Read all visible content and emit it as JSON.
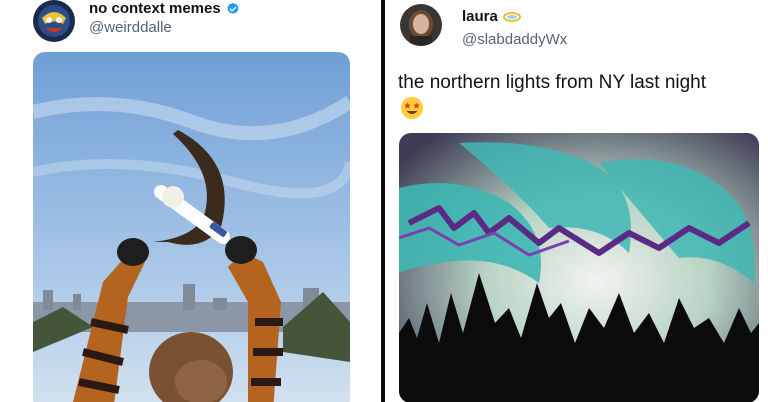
{
  "left_tweet": {
    "display_name": "no context memes",
    "handle": "@weirddalle",
    "verified": true,
    "avatar_icon": "superhero-mask-avatar",
    "media_description_icon": "hammer-sickle-photo"
  },
  "right_tweet": {
    "display_name": "laura",
    "handle": "@slabdaddyWx",
    "name_emoji": "halo-icon",
    "text": "the northern lights from NY last night",
    "text_emoji": "star-struck-emoji",
    "avatar_icon": "woman-portrait-avatar",
    "media_description_icon": "jazz-cup-aurora-photo"
  },
  "colors": {
    "verified_blue": "#1d9bf0",
    "handle_gray": "#536471",
    "divider": "#0b0b0b",
    "aurora_teal": "#3fb7b4",
    "aurora_purple": "#5a2a86"
  }
}
